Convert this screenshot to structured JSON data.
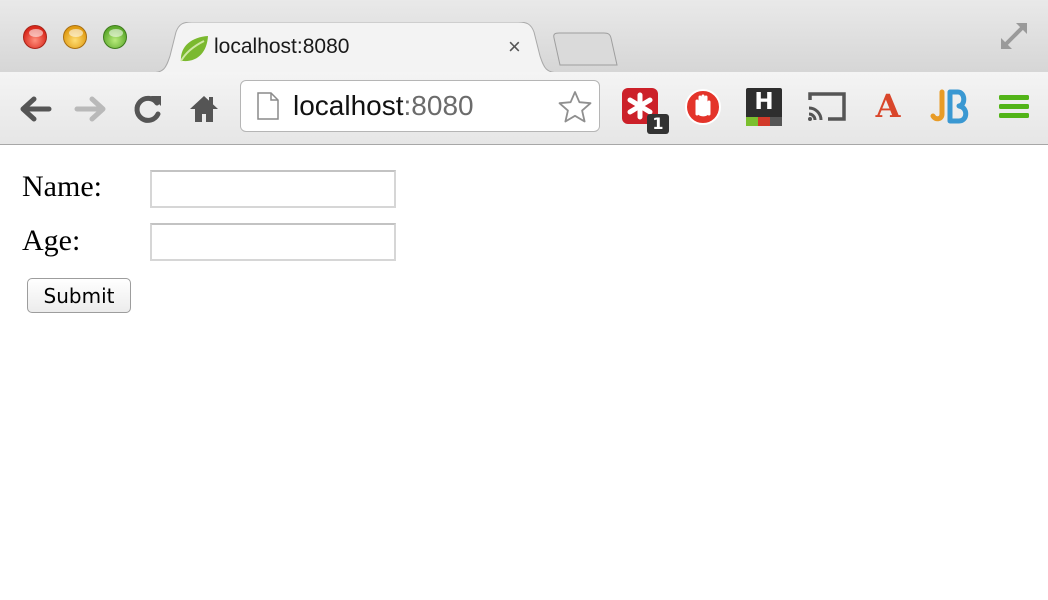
{
  "window": {
    "tab_title": "localhost:8080",
    "tab_close_glyph": "×"
  },
  "toolbar": {
    "url_host": "localhost",
    "url_port": ":8080",
    "extensions": [
      {
        "icon": "lastpass-icon",
        "badge": "1"
      },
      {
        "icon": "adblock-hand-icon"
      },
      {
        "icon": "h-extension-icon",
        "letter": "H"
      },
      {
        "icon": "cast-icon"
      },
      {
        "icon": "a-extension-icon",
        "letter": "A"
      },
      {
        "icon": "jetbrains-icon",
        "letter": "JB"
      },
      {
        "icon": "menu-icon"
      }
    ]
  },
  "form": {
    "name_label": "Name:",
    "name_value": "",
    "age_label": "Age:",
    "age_value": "",
    "submit_label": "Submit"
  },
  "colors": {
    "spring_green": "#7bb92f",
    "menu_green": "#52b418",
    "lastpass_red": "#cc2029",
    "adblock_red": "#e4342a"
  }
}
